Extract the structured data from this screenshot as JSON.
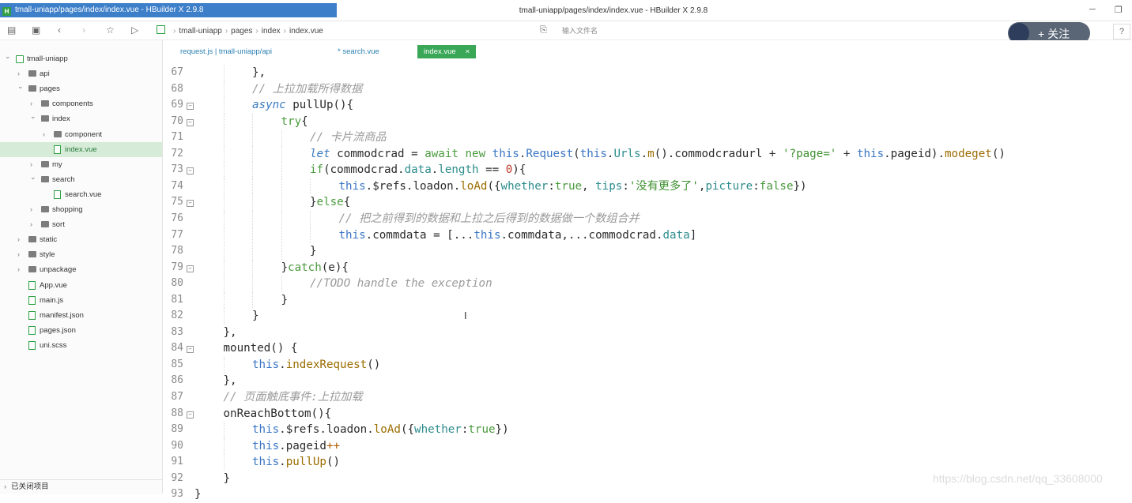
{
  "window": {
    "taskbar_hint": "tmall-uniapp/pages/index/index.vue - HBuilder X 2.9.8",
    "title": "tmall-uniapp/pages/index/index.vue - HBuilder X 2.9.8",
    "minimize": "─",
    "restore": "❐"
  },
  "toolbar": {
    "breadcrumb": [
      "tmall-uniapp",
      "pages",
      "index",
      "index.vue"
    ],
    "file_search_placeholder": "输入文件名",
    "follow_label": "+ 关注",
    "help": "?"
  },
  "sidebar": {
    "items": [
      {
        "label": "tmall-uniapp",
        "type": "project",
        "depth": 0,
        "expanded": true
      },
      {
        "label": "api",
        "type": "folder",
        "depth": 1,
        "expanded": false
      },
      {
        "label": "pages",
        "type": "folder",
        "depth": 1,
        "expanded": true
      },
      {
        "label": "components",
        "type": "folder",
        "depth": 2,
        "expanded": false
      },
      {
        "label": "index",
        "type": "folder",
        "depth": 2,
        "expanded": true
      },
      {
        "label": "component",
        "type": "folder",
        "depth": 3,
        "expanded": false
      },
      {
        "label": "index.vue",
        "type": "file",
        "depth": 3,
        "selected": true
      },
      {
        "label": "my",
        "type": "folder",
        "depth": 2,
        "expanded": false
      },
      {
        "label": "search",
        "type": "folder",
        "depth": 2,
        "expanded": true
      },
      {
        "label": "search.vue",
        "type": "file",
        "depth": 3
      },
      {
        "label": "shopping",
        "type": "folder",
        "depth": 2,
        "expanded": false
      },
      {
        "label": "sort",
        "type": "folder",
        "depth": 2,
        "expanded": false
      },
      {
        "label": "static",
        "type": "folder",
        "depth": 1,
        "expanded": false
      },
      {
        "label": "style",
        "type": "folder",
        "depth": 1,
        "expanded": false
      },
      {
        "label": "unpackage",
        "type": "folder",
        "depth": 1,
        "expanded": false
      },
      {
        "label": "App.vue",
        "type": "file",
        "depth": 1
      },
      {
        "label": "main.js",
        "type": "file",
        "depth": 1
      },
      {
        "label": "manifest.json",
        "type": "file",
        "depth": 1
      },
      {
        "label": "pages.json",
        "type": "file",
        "depth": 1
      },
      {
        "label": "uni.scss",
        "type": "file",
        "depth": 1
      }
    ],
    "closed_projects": "已关闭项目"
  },
  "tabs": [
    {
      "label": "request.js | tmall-uniapp/api",
      "active": false
    },
    {
      "label": "* search.vue",
      "active": false
    },
    {
      "label": "index.vue",
      "active": true,
      "close": "×"
    }
  ],
  "editor": {
    "lines": [
      {
        "n": "67",
        "fold": false,
        "indent": 2,
        "html": "},"
      },
      {
        "n": "68",
        "fold": false,
        "indent": 2,
        "html": "<span class='cm'>// 上拉加载所得数据</span>"
      },
      {
        "n": "69",
        "fold": true,
        "indent": 2,
        "html": "<span class='kwi'>async</span> pullUp(){"
      },
      {
        "n": "70",
        "fold": true,
        "indent": 3,
        "html": "<span class='kw'>try</span>{"
      },
      {
        "n": "71",
        "fold": false,
        "indent": 4,
        "html": "<span class='cm'>// 卡片流商品</span>"
      },
      {
        "n": "72",
        "fold": false,
        "indent": 4,
        "html": "<span class='kwi'>let</span> commodcrad = <span class='kw'>await</span> <span class='kw'>new</span> <span class='th'>this</span>.<span class='th'>Request</span>(<span class='th'>this</span>.<span class='pr'>Urls</span>.<span class='fn'>m</span>().commodcradurl + <span class='st'>'?page='</span> + <span class='th'>this</span>.pageid).<span class='fn'>modeget</span>()"
      },
      {
        "n": "73",
        "fold": true,
        "indent": 4,
        "html": "<span class='kw'>if</span>(commodcrad.<span class='pr'>data</span>.<span class='pr'>length</span> == <span class='nu'>0</span>){"
      },
      {
        "n": "74",
        "fold": false,
        "indent": 5,
        "html": "<span class='th'>this</span>.$refs.loadon.<span class='fn'>loAd</span>({<span class='pr'>whether</span>:<span class='kw'>true</span>, <span class='pr'>tips</span>:<span class='st'>'没有更多了'</span>,<span class='pr'>picture</span>:<span class='kw'>false</span>})"
      },
      {
        "n": "75",
        "fold": true,
        "indent": 4,
        "html": "}<span class='kw'>else</span>{"
      },
      {
        "n": "76",
        "fold": false,
        "indent": 5,
        "html": "<span class='cm'>// 把之前得到的数据和上拉之后得到的数据做一个数组合并</span>"
      },
      {
        "n": "77",
        "fold": false,
        "indent": 5,
        "html": "<span class='th'>this</span>.commdata = [...<span class='th'>this</span>.commdata,...commodcrad.<span class='pr'>data</span>]"
      },
      {
        "n": "78",
        "fold": false,
        "indent": 4,
        "html": "}"
      },
      {
        "n": "79",
        "fold": true,
        "indent": 3,
        "html": "}<span class='kw'>catch</span>(e){"
      },
      {
        "n": "80",
        "fold": false,
        "indent": 4,
        "html": "<span class='cm'>//TODO handle the exception</span>"
      },
      {
        "n": "81",
        "fold": false,
        "indent": 3,
        "html": "}"
      },
      {
        "n": "82",
        "fold": false,
        "indent": 2,
        "html": "}"
      },
      {
        "n": "83",
        "fold": false,
        "indent": 1,
        "html": "},"
      },
      {
        "n": "84",
        "fold": true,
        "indent": 1,
        "html": "mounted() {"
      },
      {
        "n": "85",
        "fold": false,
        "indent": 2,
        "html": "<span class='th'>this</span>.<span class='fn'>indexRequest</span>()"
      },
      {
        "n": "86",
        "fold": false,
        "indent": 1,
        "html": "},"
      },
      {
        "n": "87",
        "fold": false,
        "indent": 1,
        "html": "<span class='cm'>// 页面触底事件:上拉加载</span>"
      },
      {
        "n": "88",
        "fold": true,
        "indent": 1,
        "html": "onReachBottom(){"
      },
      {
        "n": "89",
        "fold": false,
        "indent": 2,
        "html": "<span class='th'>this</span>.$refs.loadon.<span class='fn'>loAd</span>({<span class='pr'>whether</span>:<span class='kw'>true</span>})"
      },
      {
        "n": "90",
        "fold": false,
        "indent": 2,
        "html": "<span class='th'>this</span>.pageid<span class='op'>++</span>"
      },
      {
        "n": "91",
        "fold": false,
        "indent": 2,
        "html": "<span class='th'>this</span>.<span class='fn'>pullUp</span>()"
      },
      {
        "n": "92",
        "fold": false,
        "indent": 1,
        "html": "}"
      },
      {
        "n": "93",
        "fold": false,
        "indent": 0,
        "html": "}"
      }
    ]
  },
  "watermark": "https://blog.csdn.net/qq_33608000"
}
